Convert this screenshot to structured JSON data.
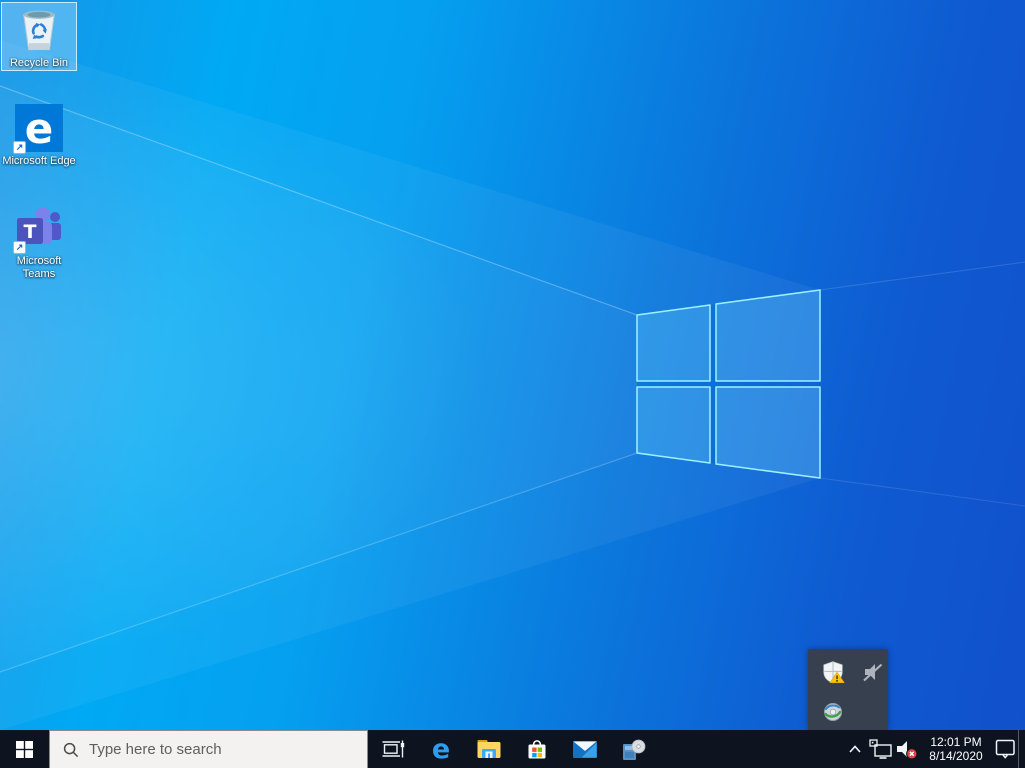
{
  "desktop": {
    "icons": [
      {
        "label": "Recycle Bin",
        "selected": true
      },
      {
        "label": "Microsoft Edge",
        "glyph": "e",
        "shortcut_glyph": "↗"
      },
      {
        "label": "Microsoft Teams",
        "glyph": "T",
        "shortcut_glyph": "↗"
      }
    ]
  },
  "tray_popup": {
    "icons": [
      {
        "name": "windows-defender-shield",
        "status": "warning"
      },
      {
        "name": "volume-muted-gray"
      },
      {
        "name": "globe-disc"
      }
    ]
  },
  "taskbar": {
    "search": {
      "placeholder": "Type here to search"
    },
    "app_buttons": [
      "task-view",
      "microsoft-edge",
      "file-explorer",
      "microsoft-store",
      "mail",
      "media-disc-app"
    ],
    "tray": {
      "time": "12:01 PM",
      "date": "8/14/2020",
      "icons": [
        "show-hidden-chevron",
        "ethernet-network",
        "volume-muted-red-x",
        "action-center"
      ]
    }
  },
  "colors": {
    "wallpaper_light": "#00a9f4",
    "wallpaper_dark": "#1150cb",
    "logo_stroke": "#9ef2ff",
    "taskbar_bg": "#0d1420",
    "search_bg": "#f3f2f1",
    "selection_fill": "#aadcfc",
    "tray_popup_bg": "#37404e",
    "mute_badge": "#e04343",
    "defender_warning": "#fdc112"
  }
}
